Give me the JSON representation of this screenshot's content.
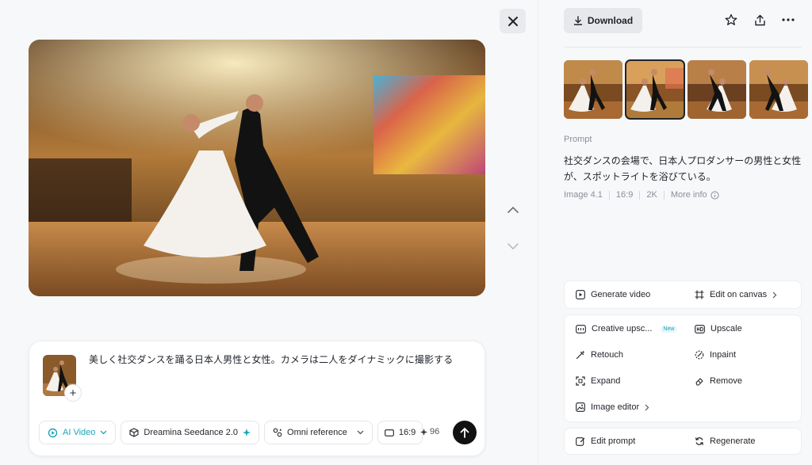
{
  "left": {
    "prompt": {
      "text": "美しく社交ダンスを踊る日本人男性と女性。カメラは二人をダイナミックに撮影する",
      "add_label": "+"
    },
    "toolbar": {
      "mode_label": "AI Video",
      "model_label": "Dreamina Seedance 2.0",
      "reference_label": "Omni reference",
      "ratio_label": "16:9",
      "credits": "96"
    }
  },
  "right": {
    "download_label": "Download",
    "prompt_label": "Prompt",
    "prompt_text": "社交ダンスの会場で、日本人プロダンサーの男性と女性が、スポットライトを浴びている。",
    "meta": {
      "model": "Image 4.1",
      "ratio": "16:9",
      "resolution": "2K",
      "more_info": "More info"
    },
    "actions": {
      "generate_video": "Generate video",
      "edit_on_canvas": "Edit on canvas",
      "creative_upscale": "Creative upsc...",
      "new_badge": "New",
      "upscale": "Upscale",
      "retouch": "Retouch",
      "inpaint": "Inpaint",
      "expand": "Expand",
      "remove": "Remove",
      "image_editor": "Image editor",
      "edit_prompt": "Edit prompt",
      "regenerate": "Regenerate"
    }
  },
  "icons": {
    "close": "close-icon",
    "up": "chevron-up-icon",
    "down": "chevron-down-icon",
    "download": "download-icon",
    "star": "star-icon",
    "share": "share-icon",
    "more": "more-icon",
    "send": "arrow-up-icon",
    "info": "info-icon"
  }
}
